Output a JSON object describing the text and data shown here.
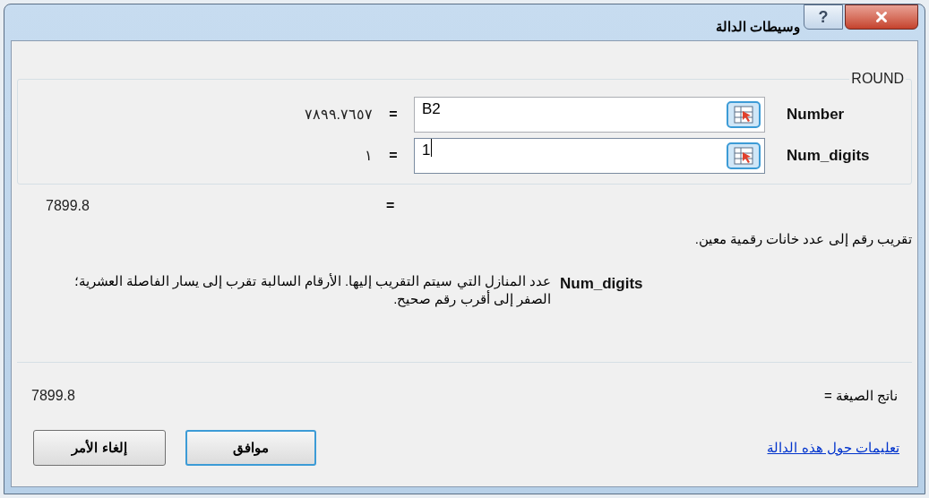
{
  "window": {
    "title": "وسيطات الدالة",
    "help_glyph": "?"
  },
  "function": {
    "name": "ROUND",
    "arguments": [
      {
        "label": "Number",
        "value": "B2",
        "result": "٧٨٩٩.٧٦٥٧",
        "focused": false
      },
      {
        "label": "Num_digits",
        "value": "1",
        "result": "١",
        "focused": true
      }
    ],
    "equals": "=",
    "preview": "7899.8",
    "description": "تقريب رقم إلى عدد خانات رقمية معين."
  },
  "argument_help": {
    "label": "Num_digits",
    "text": "عدد المنازل التي سيتم التقريب إليها. الأرقام السالبة تقرب إلى يسار الفاصلة العشرية؛ الصفر إلى أقرب رقم صحيح."
  },
  "formula_result": {
    "label": "ناتج الصيغة =",
    "value": "7899.8"
  },
  "help_link": "تعليمات حول هذه الدالة",
  "buttons": [
    {
      "label": "موافق",
      "default": true
    },
    {
      "label": "إلغاء الأمر",
      "default": false
    }
  ]
}
